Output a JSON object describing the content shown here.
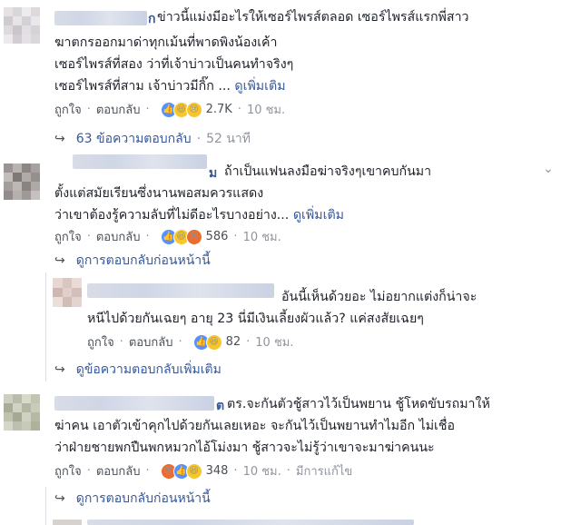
{
  "comments": [
    {
      "name_tail": "ก",
      "lines": [
        "ข่าวนี้แม่งมีอะไรให้เซอร์ไพรส์ตลอด เซอร์ไพรส์แรกพี่สาว",
        "ฆาตกรออกมาด่าทุกเม้นที่พาดพิงน้องเค้า",
        "เซอร์ไพรส์ที่สอง ว่าที่เจ้าบ่าวเป็นคนทำจริงๆ",
        "เซอร์ไพรส์ที่สาม เจ้าบ่าวมีกิ๊ก ..."
      ],
      "see_more": "ดูเพิ่มเติม",
      "like_label": "ถูกใจ",
      "reply_label": "ตอบกลับ",
      "reaction_count": "2.7K",
      "time": "10 ชม.",
      "replies_link": "63 ข้อความตอบกลับ",
      "replies_time": "52 นาที"
    },
    {
      "name_tail": "ม",
      "lines": [
        "ถ้าเป็นแฟนลงมือฆ่าจริงๆเขาคบกันมา",
        "ตั้งแต่สมัยเรียนซึ่งนานพอสมควรแสดง",
        "ว่าเขาต้องรู้ความลับที่ไม่ดีอะไรบางอย่าง..."
      ],
      "see_more": "ดูเพิ่มเติม",
      "like_label": "ถูกใจ",
      "reply_label": "ตอบกลับ",
      "reaction_count": "586",
      "time": "10 ชม.",
      "previous_replies": "ดูการตอบกลับก่อนหน้านี้"
    },
    {
      "lines": [
        "อันนี้เห็นด้วยอะ ไม่อยากแต่งก็น่าจะ",
        "หนีไปด้วยกันเฉยๆ อายุ 23 นี่มีเงินเลี้ยงผัวแล้ว? แค่สงสัยเฉยๆ"
      ],
      "like_label": "ถูกใจ",
      "reply_label": "ตอบกลับ",
      "reaction_count": "82",
      "time": "10 ชม.",
      "more_replies": "ดูข้อความตอบกลับเพิ่มเติม"
    },
    {
      "name_tail": "ต",
      "lines": [
        "ตร.จะกันตัวชู้สาวไว้เป็นพยาน ชู้โหดขับรถมาให้",
        "ฆ่าคน เอาตัวเข้าคุกไปด้วยกันเลยเหอะ จะกันไว้เป็นพยานทำไมอีก ไม่เชื่อ",
        "ว่าฝ่ายชายพกปืนพกหมวกไอ้โม่งมา ชู้สาวจะไม่รู้ว่าเขาจะมาฆ่าคนนะ"
      ],
      "like_label": "ถูกใจ",
      "reply_label": "ตอบกลับ",
      "reaction_count": "348",
      "time": "10 ชม.",
      "edited": "มีการแก้ไข",
      "previous_replies": "ดูการตอบกลับก่อนหน้านี้"
    }
  ],
  "icons": {
    "like": "like-icon",
    "haha": "haha-icon",
    "sad": "sad-icon",
    "angry": "angry-icon",
    "reply_arrow": "reply-arrow-icon",
    "options": "chevron-down-icon"
  },
  "colors": {
    "link": "#365899",
    "meta": "#90949c",
    "text": "#1d2129",
    "like_blue": "#5890ff",
    "emoji_yellow": "#f7c52c",
    "angry_orange": "#ee6b2e"
  }
}
